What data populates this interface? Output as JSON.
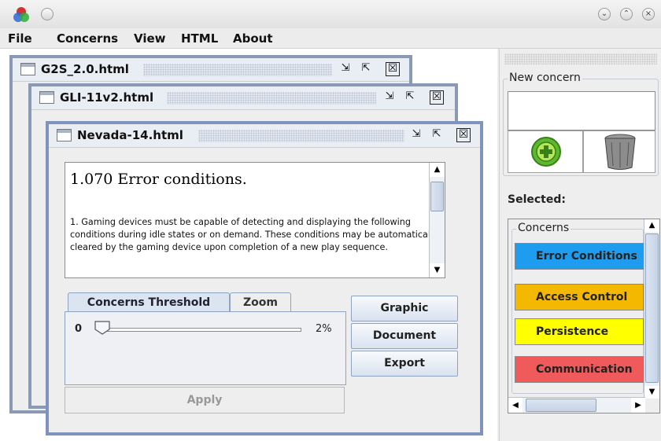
{
  "titlebar": {
    "icons": [
      "app-logo-icon",
      "round-button-icon"
    ],
    "controls": [
      "minimize-icon",
      "maximize-icon",
      "close-icon"
    ],
    "minimize_glyph": "⌄",
    "maximize_glyph": "⌃",
    "close_glyph": "×"
  },
  "menu": [
    "File",
    "Concerns",
    "View",
    "HTML",
    "About"
  ],
  "windows": [
    {
      "title": "G2S_2.0.html"
    },
    {
      "title": "GLI-11v2.html"
    },
    {
      "title": "Nevada-14.html"
    }
  ],
  "window_controls": {
    "iconify": "⇲",
    "maximize": "⇱",
    "close": "☒"
  },
  "document": {
    "heading": "1.070  Error conditions.",
    "body": "1. Gaming devices must be capable of detecting and displaying the following conditions during idle states or on demand. These conditions may be automatically cleared by the gaming device upon completion of a new play sequence."
  },
  "tabs": [
    {
      "label": "Concerns Threshold",
      "active": true
    },
    {
      "label": "Zoom",
      "active": false
    }
  ],
  "slider": {
    "min_label": "0",
    "max_label": "2%",
    "value_fraction": 0.0
  },
  "apply_label": "Apply",
  "side_buttons": [
    "Graphic",
    "Document",
    "Export"
  ],
  "right_panel": {
    "new_concern_label": "New concern",
    "new_concern_value": "",
    "add_icon": "add-concern-icon",
    "delete_icon": "trash-can-icon",
    "selected_label": "Selected:",
    "concerns_label": "Concerns",
    "concerns": [
      {
        "label": "Error Conditions",
        "color": "#1e9cf0"
      },
      {
        "label": "Access Control",
        "color": "#f5b800"
      },
      {
        "label": "Persistence",
        "color": "#ffff00"
      },
      {
        "label": "Communication",
        "color": "#f05a5a"
      }
    ]
  }
}
